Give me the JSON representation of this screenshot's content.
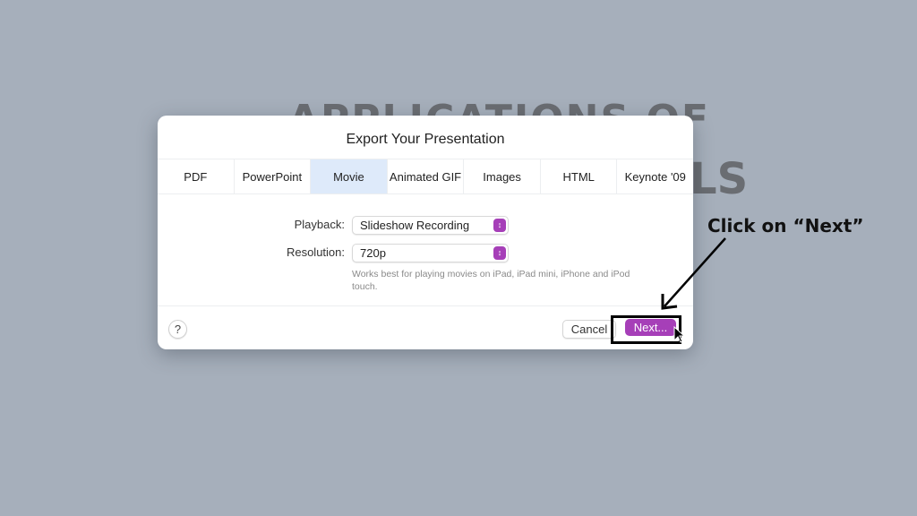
{
  "background": {
    "slide_title_line1": "APPLICATIONS OF",
    "slide_title_line2": "LS"
  },
  "dialog": {
    "title": "Export Your Presentation",
    "tabs": [
      {
        "label": "PDF",
        "active": false
      },
      {
        "label": "PowerPoint",
        "active": false
      },
      {
        "label": "Movie",
        "active": true
      },
      {
        "label": "Animated GIF",
        "active": false
      },
      {
        "label": "Images",
        "active": false
      },
      {
        "label": "HTML",
        "active": false
      },
      {
        "label": "Keynote '09",
        "active": false
      }
    ],
    "playback": {
      "label": "Playback:",
      "value": "Slideshow Recording"
    },
    "resolution": {
      "label": "Resolution:",
      "value": "720p"
    },
    "hint": "Works best for playing movies on iPad, iPad mini, iPhone and iPod touch.",
    "help_label": "?",
    "cancel_label": "Cancel",
    "next_label": "Next..."
  },
  "annotation": {
    "text": "Click on “Next”"
  },
  "colors": {
    "accent": "#a63fb8",
    "active_tab": "#deeafa",
    "background": "#a6afbb"
  }
}
